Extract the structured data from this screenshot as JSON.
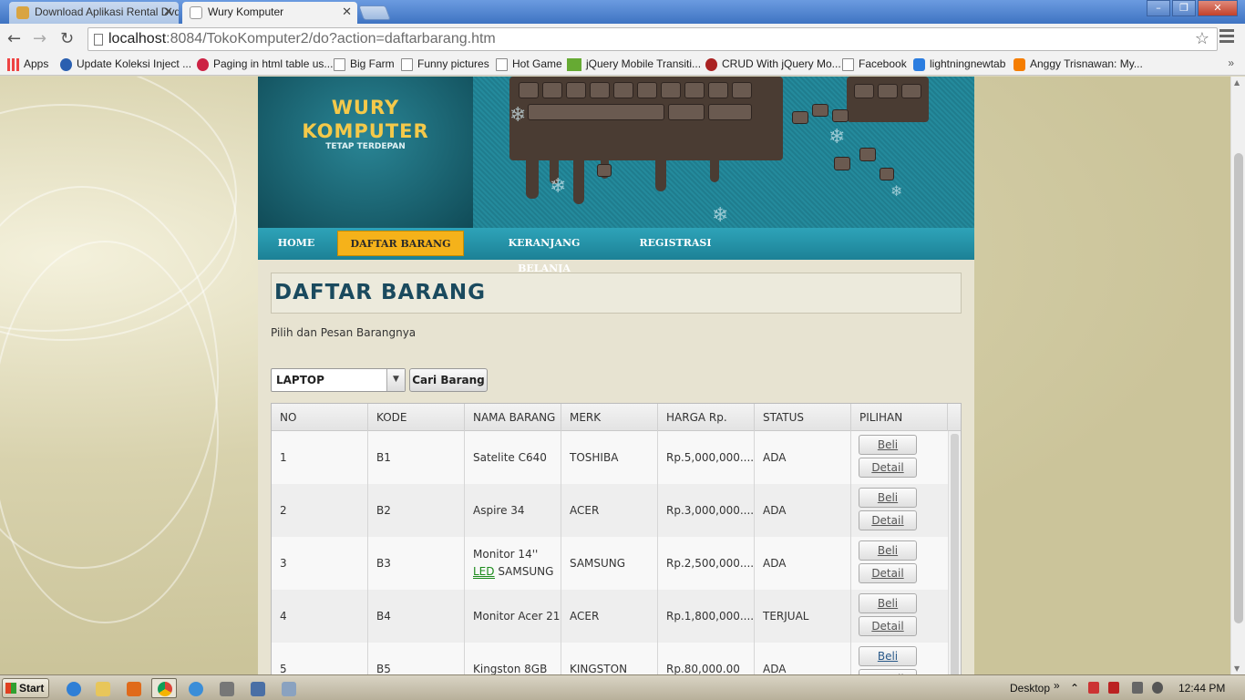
{
  "browser": {
    "tabs": [
      {
        "title": "Download Aplikasi Rental Dvd",
        "active": false
      },
      {
        "title": "Wury Komputer",
        "active": true
      }
    ],
    "url_host": "localhost",
    "url_rest": ":8084/TokoKomputer2/do?action=daftarbarang.htm",
    "bookmarks": [
      {
        "label": "Apps",
        "icon": "apps-grid-icon"
      },
      {
        "label": "Update Koleksi Inject ...",
        "icon": "bird-icon"
      },
      {
        "label": "Paging in html table us...",
        "icon": "site-icon"
      },
      {
        "label": "Big Farm",
        "icon": "page-icon"
      },
      {
        "label": "Funny pictures",
        "icon": "page-icon"
      },
      {
        "label": "Hot Game",
        "icon": "page-icon"
      },
      {
        "label": "jQuery Mobile Transiti...",
        "icon": "w3-icon"
      },
      {
        "label": "CRUD With jQuery Mo...",
        "icon": "site-icon"
      },
      {
        "label": "Facebook",
        "icon": "page-icon"
      },
      {
        "label": "lightningnewtab",
        "icon": "lightning-icon"
      },
      {
        "label": "Anggy Trisnawan: My...",
        "icon": "blogger-icon"
      }
    ]
  },
  "site": {
    "logo_line1": "WURY",
    "logo_line2": "KOMPUTER",
    "tagline": "TETAP TERDEPAN",
    "nav": [
      {
        "label": "HOME",
        "active": false
      },
      {
        "label": "DAFTAR BARANG",
        "active": true
      },
      {
        "label": "KERANJANG BELANJA",
        "active": false
      },
      {
        "label": "REGISTRASI",
        "active": false
      }
    ],
    "page_title": "DAFTAR BARANG",
    "subtitle": "Pilih dan Pesan Barangnya",
    "category_select": "LAPTOP",
    "search_button": "Cari Barang"
  },
  "table": {
    "columns": [
      "NO",
      "KODE",
      "NAMA BARANG",
      "MERK",
      "HARGA Rp.",
      "STATUS",
      "PILIHAN"
    ],
    "rows": [
      {
        "no": "1",
        "kode": "B1",
        "nama": "Satelite C640",
        "nama_extra": "",
        "merk": "TOSHIBA",
        "harga": "Rp.5,000,000....",
        "status": "ADA"
      },
      {
        "no": "2",
        "kode": "B2",
        "nama": "Aspire 34",
        "nama_extra": "",
        "merk": "ACER",
        "harga": "Rp.3,000,000....",
        "status": "ADA"
      },
      {
        "no": "3",
        "kode": "B3",
        "nama": "Monitor 14''",
        "nama_led": "LED",
        "nama_extra": "SAMSUNG",
        "merk": "SAMSUNG",
        "harga": "Rp.2,500,000....",
        "status": "ADA"
      },
      {
        "no": "4",
        "kode": "B4",
        "nama": "Monitor Acer 21",
        "nama_extra": "",
        "merk": "ACER",
        "harga": "Rp.1,800,000....",
        "status": "TERJUAL"
      },
      {
        "no": "5",
        "kode": "B5",
        "nama": "Kingston 8GB",
        "nama_extra": "",
        "merk": "KINGSTON",
        "harga": "Rp.80,000.00",
        "status": "ADA"
      }
    ],
    "buy_label": "Beli",
    "detail_label": "Detail"
  },
  "taskbar": {
    "start": "Start",
    "desktop": "Desktop",
    "clock": "12:44 PM"
  }
}
